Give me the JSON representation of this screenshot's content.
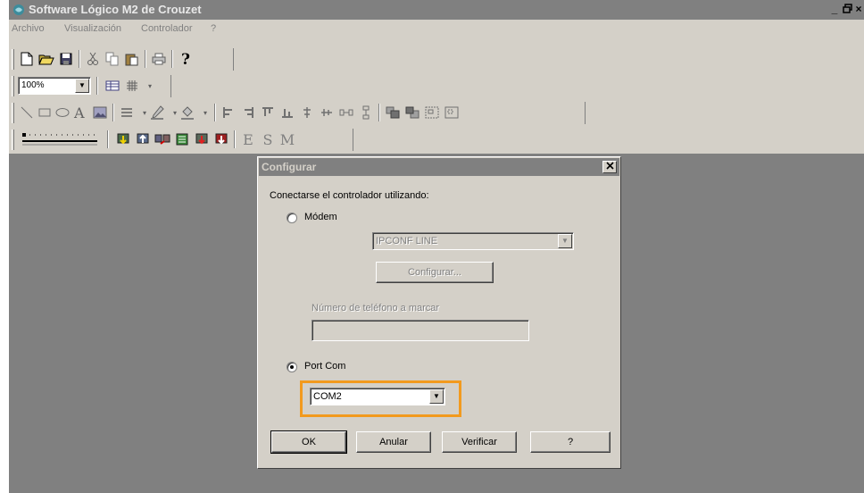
{
  "window": {
    "title": "Software Lógico M2 de Crouzet",
    "controls": [
      "_",
      "▫",
      "×"
    ]
  },
  "menu": {
    "items": [
      "Archivo",
      "Visualización",
      "Controlador",
      "?"
    ]
  },
  "toolbar2": {
    "zoom_value": "100%"
  },
  "toolbar4": {
    "esm_letters": [
      "E",
      "S",
      "M"
    ]
  },
  "dialog": {
    "title": "Configurar",
    "prompt": "Conectarse el controlador utilizando:",
    "modem": {
      "label": "Módem",
      "selected": false,
      "line_value": "IPCONF LINE",
      "configure_label": "Configurar...",
      "phone_label": "Número de teléfono a marcar",
      "phone_value": ""
    },
    "portcom": {
      "label": "Port Com",
      "selected": true,
      "value": "COM2"
    },
    "buttons": {
      "ok": "OK",
      "cancel": "Anular",
      "verify": "Verificar",
      "help": "?"
    }
  },
  "colors": {
    "highlight": "#f29a1e",
    "workspace": "#808080",
    "face": "#d4d0c8"
  }
}
